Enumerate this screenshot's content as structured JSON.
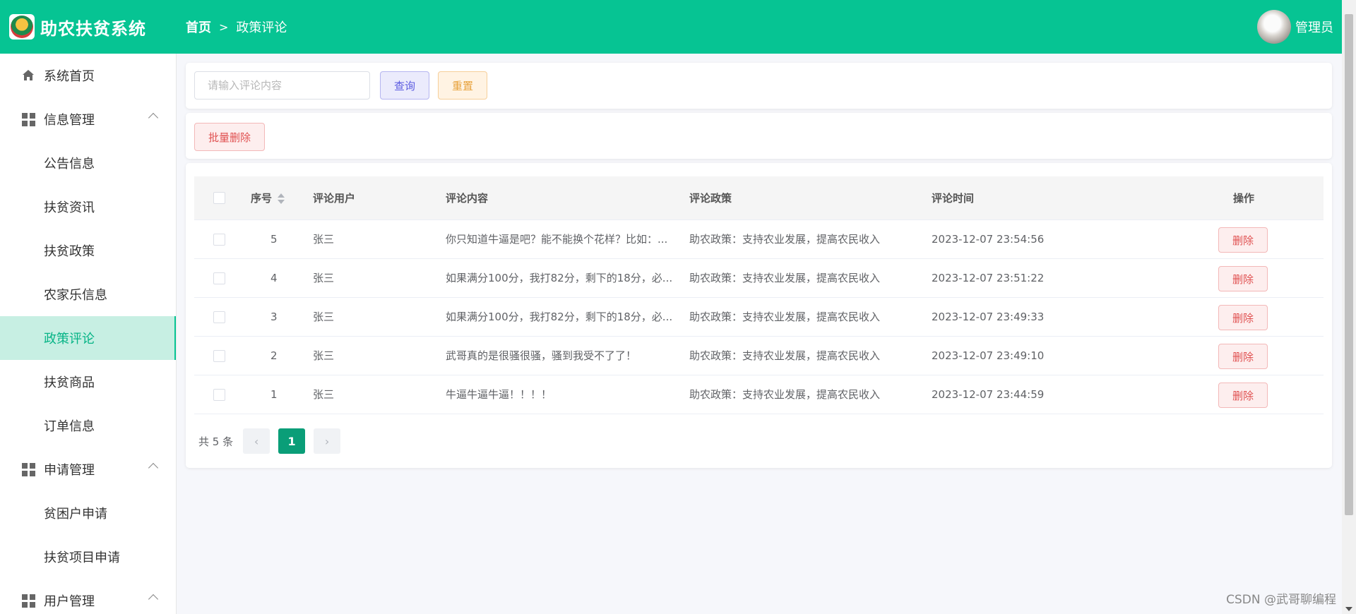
{
  "header": {
    "app_title": "助农扶贫系统",
    "breadcrumb_home": "首页",
    "breadcrumb_sep": ">",
    "breadcrumb_current": "政策评论",
    "user_name": "管理员",
    "brand_color": "#06c493"
  },
  "sidebar": {
    "items": [
      {
        "label": "系统首页",
        "icon": "home-icon"
      },
      {
        "label": "信息管理",
        "icon": "grid-icon"
      },
      {
        "label": "公告信息"
      },
      {
        "label": "扶贫资讯"
      },
      {
        "label": "扶贫政策"
      },
      {
        "label": "农家乐信息"
      },
      {
        "label": "政策评论"
      },
      {
        "label": "扶贫商品"
      },
      {
        "label": "订单信息"
      },
      {
        "label": "申请管理",
        "icon": "grid-icon"
      },
      {
        "label": "贫困户申请"
      },
      {
        "label": "扶贫项目申请"
      },
      {
        "label": "用户管理",
        "icon": "grid-icon"
      }
    ]
  },
  "search": {
    "placeholder": "请输入评论内容",
    "query_label": "查询",
    "reset_label": "重置"
  },
  "actions": {
    "batch_delete_label": "批量删除"
  },
  "table": {
    "columns": [
      "序号",
      "评论用户",
      "评论内容",
      "评论政策",
      "评论时间",
      "操作"
    ],
    "rows": [
      {
        "id": "5",
        "user": "张三",
        "content": "你只知道牛逼是吧？能不能换个花样？比如：...",
        "policy": "助农政策：支持农业发展，提高农民收入",
        "time": "2023-12-07 23:54:56",
        "action": "删除"
      },
      {
        "id": "4",
        "user": "张三",
        "content": "如果满分100分，我打82分，剩下的18分，必...",
        "policy": "助农政策：支持农业发展，提高农民收入",
        "time": "2023-12-07 23:51:22",
        "action": "删除"
      },
      {
        "id": "3",
        "user": "张三",
        "content": "如果满分100分，我打82分，剩下的18分，必...",
        "policy": "助农政策：支持农业发展，提高农民收入",
        "time": "2023-12-07 23:49:33",
        "action": "删除"
      },
      {
        "id": "2",
        "user": "张三",
        "content": "武哥真的是很骚很骚，骚到我受不了了！",
        "policy": "助农政策：支持农业发展，提高农民收入",
        "time": "2023-12-07 23:49:10",
        "action": "删除"
      },
      {
        "id": "1",
        "user": "张三",
        "content": "牛逼牛逼牛逼！！！！",
        "policy": "助农政策：支持农业发展，提高农民收入",
        "time": "2023-12-07 23:44:59",
        "action": "删除"
      }
    ]
  },
  "pagination": {
    "total_text": "共 5 条",
    "current_page": "1",
    "prev_icon": "‹",
    "next_icon": "›"
  },
  "watermark": "CSDN @武哥聊编程"
}
